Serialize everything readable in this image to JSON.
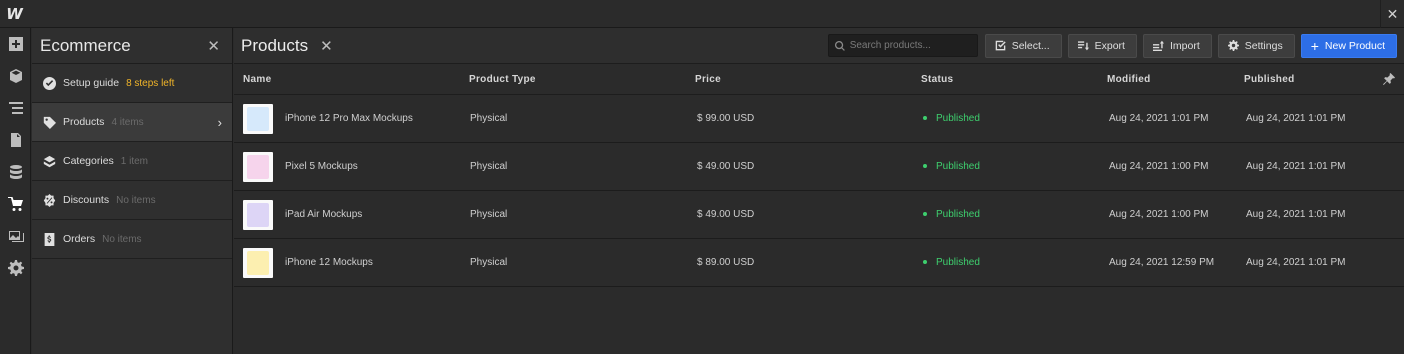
{
  "app": {
    "logo_text": "W",
    "close_icon": "close-icon"
  },
  "rail": [
    {
      "name": "add-panel-icon"
    },
    {
      "name": "box-icon"
    },
    {
      "name": "navigator-icon"
    },
    {
      "name": "pages-icon"
    },
    {
      "name": "cms-icon"
    },
    {
      "name": "cart-icon",
      "active": true
    },
    {
      "name": "assets-icon"
    },
    {
      "name": "settings-icon"
    }
  ],
  "panel": {
    "title": "Ecommerce",
    "items": [
      {
        "label": "Setup guide",
        "meta": "8 steps left",
        "icon": "check-circle-icon",
        "warn": true
      },
      {
        "label": "Products",
        "meta": "4 items",
        "icon": "tag-icon",
        "active": true
      },
      {
        "label": "Categories",
        "meta": "1 item",
        "icon": "layers-icon"
      },
      {
        "label": "Discounts",
        "meta": "No items",
        "icon": "discount-icon"
      },
      {
        "label": "Orders",
        "meta": "No items",
        "icon": "receipt-icon"
      }
    ]
  },
  "main": {
    "title": "Products",
    "search_placeholder": "Search products...",
    "buttons": {
      "select": "Select...",
      "export": "Export",
      "import": "Import",
      "settings": "Settings",
      "new_product": "New Product"
    },
    "columns": [
      "Name",
      "Product Type",
      "Price",
      "Status",
      "Modified",
      "Published"
    ],
    "rows": [
      {
        "name": "iPhone 12 Pro Max Mockups",
        "type": "Physical",
        "price": "$ 99.00 USD",
        "status": "Published",
        "modified": "Aug 24, 2021 1:01 PM",
        "published": "Aug 24, 2021 1:01 PM",
        "thumb_color": "#d6e9fb"
      },
      {
        "name": "Pixel 5 Mockups",
        "type": "Physical",
        "price": "$ 49.00 USD",
        "status": "Published",
        "modified": "Aug 24, 2021 1:00 PM",
        "published": "Aug 24, 2021 1:01 PM",
        "thumb_color": "#f6d4ec"
      },
      {
        "name": "iPad Air Mockups",
        "type": "Physical",
        "price": "$ 49.00 USD",
        "status": "Published",
        "modified": "Aug 24, 2021 1:00 PM",
        "published": "Aug 24, 2021 1:01 PM",
        "thumb_color": "#ddd5f6"
      },
      {
        "name": "iPhone 12 Mockups",
        "type": "Physical",
        "price": "$ 89.00 USD",
        "status": "Published",
        "modified": "Aug 24, 2021 12:59 PM",
        "published": "Aug 24, 2021 1:01 PM",
        "thumb_color": "#fcefb0"
      }
    ]
  },
  "colors": {
    "accent": "#2d6ee6",
    "published": "#3ecf6e",
    "warn": "#f0b429"
  }
}
